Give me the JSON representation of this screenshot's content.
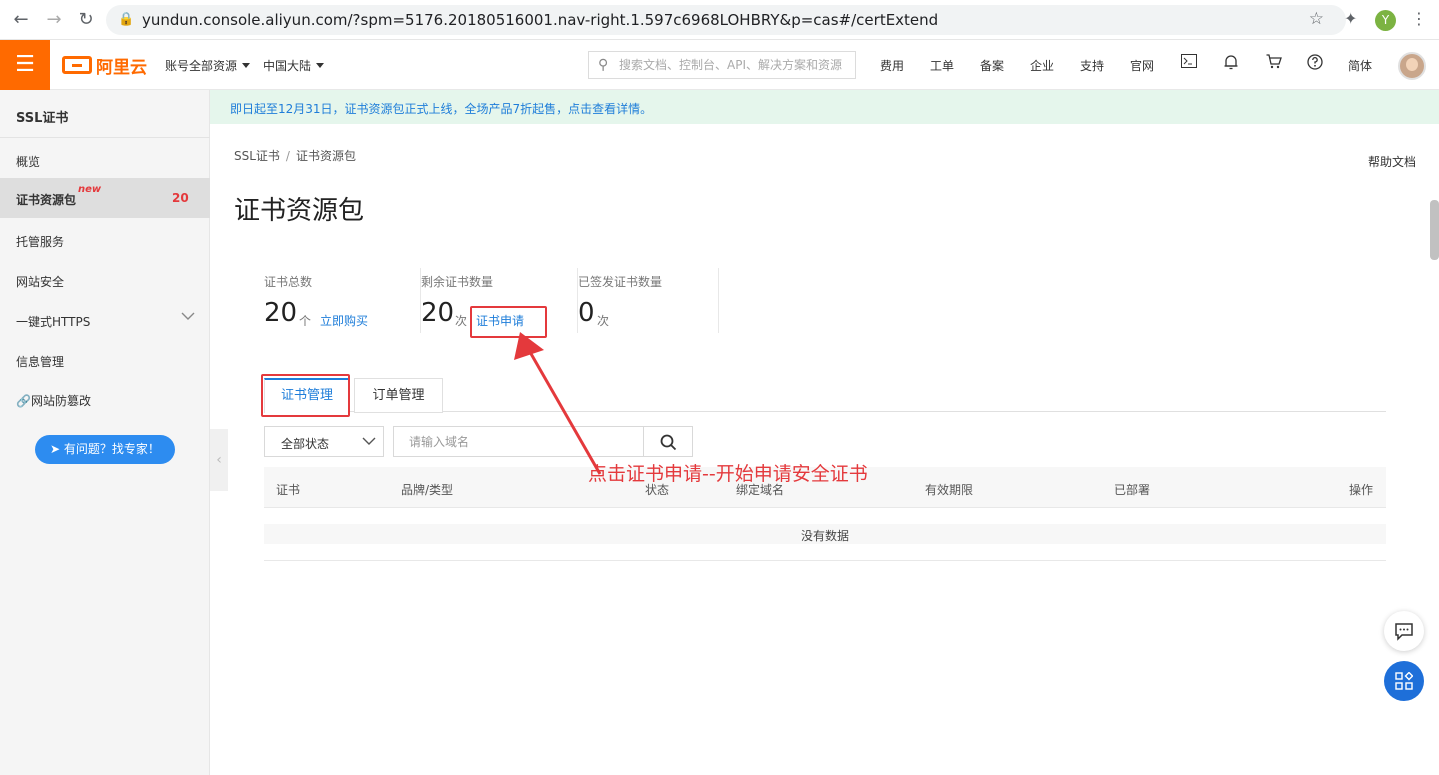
{
  "browser": {
    "url": "yundun.console.aliyun.com/?spm=5176.20180516001.nav-right.1.597c6968LOHBRY&p=cas#/certExtend",
    "profile_initial": "Y"
  },
  "topbar": {
    "brand": "阿里云",
    "account_dropdown": "账号全部资源",
    "region_dropdown": "中国大陆",
    "search_placeholder": "搜索文档、控制台、API、解决方案和资源",
    "nav": [
      "费用",
      "工单",
      "备案",
      "企业",
      "支持",
      "官网"
    ],
    "language": "简体"
  },
  "sidebar": {
    "title": "SSL证书",
    "items": [
      {
        "label": "概览"
      },
      {
        "label": "证书资源包",
        "badge": "new",
        "count": "20"
      },
      {
        "label": "托管服务"
      },
      {
        "label": "网站安全"
      },
      {
        "label": "一键式HTTPS"
      },
      {
        "label": "信息管理"
      },
      {
        "label": "网站防篡改"
      }
    ],
    "help_button": "有问题？找专家！"
  },
  "notice": {
    "text": "即日起至12月31日，证书资源包正式上线，全场产品7折起售，点击查看详情。"
  },
  "breadcrumb": [
    "SSL证书",
    "证书资源包"
  ],
  "help_doc": "帮助文档",
  "page_title": "证书资源包",
  "stats": [
    {
      "label": "证书总数",
      "value": "20",
      "unit": "个",
      "link": "立即购买"
    },
    {
      "label": "剩余证书数量",
      "value": "20",
      "unit": "次",
      "link": "证书申请"
    },
    {
      "label": "已签发证书数量",
      "value": "0",
      "unit": "次"
    }
  ],
  "tabs": [
    {
      "label": "证书管理",
      "active": true
    },
    {
      "label": "订单管理",
      "active": false
    }
  ],
  "filter": {
    "status_select": "全部状态",
    "domain_placeholder": "请输入域名"
  },
  "table": {
    "columns": [
      "证书",
      "品牌/类型",
      "状态",
      "绑定域名",
      "有效期限",
      "已部署",
      "操作"
    ],
    "empty_text": "没有数据"
  },
  "annotation": {
    "text": "点击证书申请--开始申请安全证书",
    "color": "#e4393c"
  },
  "colors": {
    "brand": "#ff6a00",
    "link": "#1e7dd9",
    "notice_bg": "#e5f6ec"
  }
}
